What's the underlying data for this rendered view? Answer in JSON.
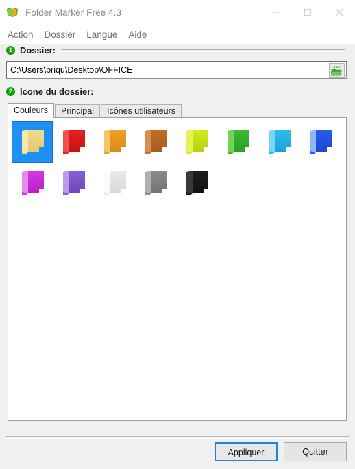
{
  "window": {
    "title": "Folder Marker Free 4.3",
    "app_icon": "folder-marker-logo",
    "controls": {
      "minimize": "minimize-icon",
      "maximize": "maximize-icon",
      "close": "close-icon"
    }
  },
  "menu": {
    "items": [
      {
        "label": "Action"
      },
      {
        "label": "Dossier"
      },
      {
        "label": "Langue"
      },
      {
        "label": "Aide"
      }
    ]
  },
  "steps": {
    "folder": {
      "number": "1",
      "label": "Dossier:",
      "path_value": "C:\\Users\\briqu\\Desktop\\OFFICE",
      "path_placeholder": "C:\\",
      "browse_icon": "open-folder-icon"
    },
    "icon": {
      "number": "2",
      "label": "Icone du dossier:",
      "tabs": [
        {
          "label": "Couleurs",
          "active": true
        },
        {
          "label": "Principal",
          "active": false
        },
        {
          "label": "Icônes utilisateurs",
          "active": false
        }
      ]
    }
  },
  "folders": [
    {
      "name": "yellow",
      "light": "#f7e9a8",
      "mid": "#f3dc8c",
      "dark": "#e3c86c",
      "selected": true
    },
    {
      "name": "red",
      "light": "#f05050",
      "mid": "#ea2020",
      "dark": "#c41414",
      "selected": false
    },
    {
      "name": "orange",
      "light": "#f8c468",
      "mid": "#f2a02a",
      "dark": "#da8a18",
      "selected": false
    },
    {
      "name": "brown",
      "light": "#d2914f",
      "mid": "#c0702a",
      "dark": "#a45c1e",
      "selected": false
    },
    {
      "name": "lime",
      "light": "#e6f452",
      "mid": "#d4ec22",
      "dark": "#b6cf10",
      "selected": false
    },
    {
      "name": "green",
      "light": "#76d35a",
      "mid": "#3cbb33",
      "dark": "#2a9e26",
      "selected": false
    },
    {
      "name": "light-blue",
      "light": "#7bd6f5",
      "mid": "#2cbdee",
      "dark": "#18a3d6",
      "selected": false
    },
    {
      "name": "blue",
      "light": "#8fb7f0",
      "mid": "#2a5ef0",
      "dark": "#1c46cc",
      "selected": false
    },
    {
      "name": "magenta",
      "light": "#e58af0",
      "mid": "#d539e2",
      "dark": "#b820c6",
      "selected": false
    },
    {
      "name": "purple",
      "light": "#b89bea",
      "mid": "#8a5fd6",
      "dark": "#7046bc",
      "selected": false
    },
    {
      "name": "white",
      "light": "#fbfbfb",
      "mid": "#ebebeb",
      "dark": "#d8d8d8",
      "selected": false
    },
    {
      "name": "gray",
      "light": "#b0b0b0",
      "mid": "#8c8c8c",
      "dark": "#737373",
      "selected": false
    },
    {
      "name": "black",
      "light": "#3a3a3a",
      "mid": "#1e1e1e",
      "dark": "#111111",
      "selected": false
    }
  ],
  "footer": {
    "apply_label": "Appliquer",
    "quit_label": "Quitter"
  }
}
